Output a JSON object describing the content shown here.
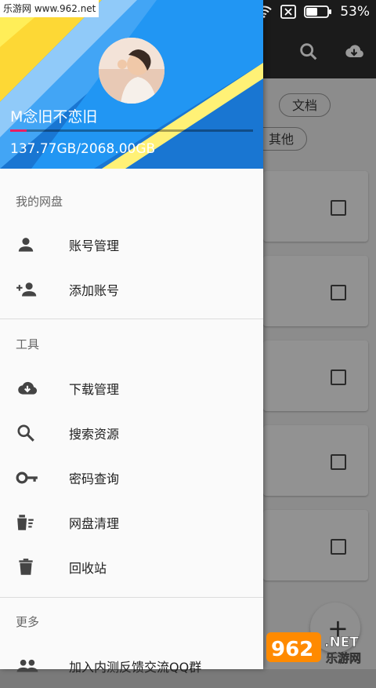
{
  "status_bar": {
    "site_tag": "乐游网 www.962.net",
    "battery": "53%"
  },
  "background": {
    "chips": [
      "文档",
      "其他"
    ]
  },
  "drawer": {
    "header": {
      "username": "M念旧不恋旧",
      "quota": "137.77GB/2068.00GB",
      "quota_used_fraction": 0.067
    },
    "sections": [
      {
        "label": "我的网盘",
        "items": [
          {
            "label": "账号管理",
            "icon": "person-icon"
          },
          {
            "label": "添加账号",
            "icon": "person-add-icon"
          }
        ]
      },
      {
        "label": "工具",
        "items": [
          {
            "label": "下载管理",
            "icon": "cloud-download-icon"
          },
          {
            "label": "搜索资源",
            "icon": "search-icon"
          },
          {
            "label": "密码查询",
            "icon": "key-icon"
          },
          {
            "label": "网盘清理",
            "icon": "clean-icon"
          },
          {
            "label": "回收站",
            "icon": "trash-icon"
          }
        ]
      },
      {
        "label": "更多",
        "items": [
          {
            "label": "加入内测反馈交流QQ群",
            "icon": "group-icon"
          }
        ]
      }
    ]
  },
  "watermark": {
    "text": "962.NET",
    "subtext": "乐游网"
  },
  "colors": {
    "header_blue": "#1e88e5",
    "quota_pink": "#e91e63",
    "icon_gray": "#444444"
  }
}
